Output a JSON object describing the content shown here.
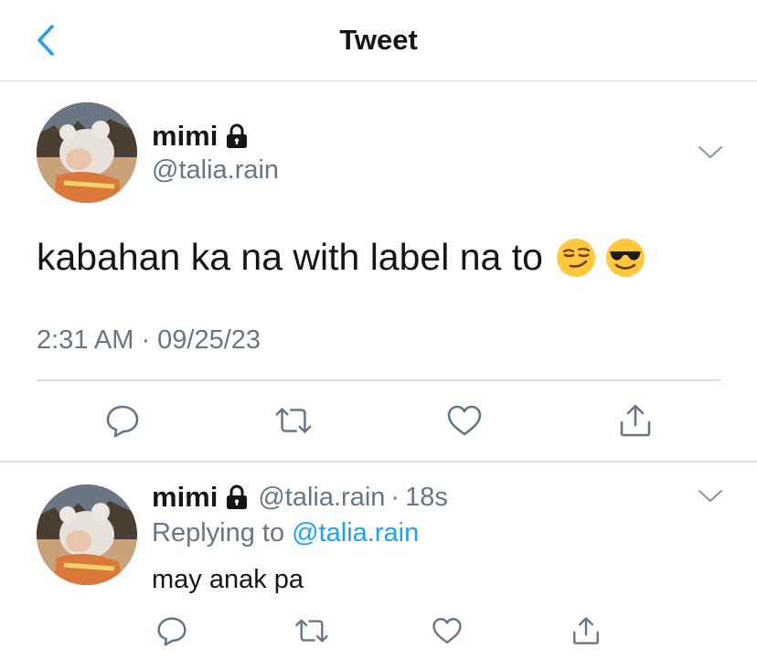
{
  "header": {
    "title": "Tweet"
  },
  "tweet": {
    "author_name": "mimi",
    "author_handle": "@talia.rain",
    "text": "kabahan ka na with label na to",
    "emojis": [
      "smirking-face",
      "smiling-face-with-sunglasses"
    ],
    "timestamp": "2:31 AM · 09/25/23"
  },
  "reply": {
    "author_name": "mimi",
    "author_handle": "@talia.rain",
    "separator": "·",
    "age": "18s",
    "replying_prefix": "Replying to",
    "replying_to": "@talia.rain",
    "text": "may anak pa"
  },
  "icons": {
    "back": "chevron-left-icon",
    "lock": "lock-icon",
    "caret": "chevron-down-icon",
    "reply": "comment-icon",
    "retweet": "retweet-icon",
    "like": "heart-icon",
    "share": "share-icon"
  },
  "colors": {
    "accent": "#1da1f2",
    "text": "#14171a",
    "secondary": "#657786",
    "divider": "#dcdfe2"
  }
}
